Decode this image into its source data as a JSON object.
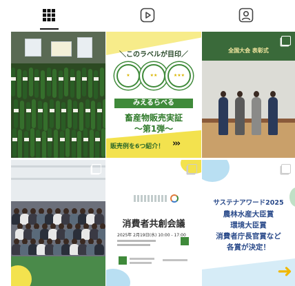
{
  "tabs": [
    {
      "name": "posts",
      "icon": "grid-icon",
      "active": true
    },
    {
      "name": "reels",
      "icon": "reels-icon",
      "active": false
    },
    {
      "name": "tagged",
      "icon": "tagged-user-icon",
      "active": false
    }
  ],
  "posts": {
    "post2": {
      "headline": "＼このラベルが目印／",
      "badges": [
        "★",
        "★★",
        "★★★"
      ],
      "band": "みえるらべる",
      "title_line1": "畜産物販売実証",
      "title_line2": "～第1弾～",
      "cta": "販売例を6つ紹介！",
      "arrows": "›››"
    },
    "post3": {
      "banner": "全国大会 表彰式"
    },
    "post5": {
      "title": "消費者共創会議",
      "date": "2025年 2月19日(水) 10:00 - 17:00"
    },
    "post6": {
      "line1": "サステナアワード2025",
      "line2": "農林水産大臣賞",
      "line3": "環境大臣賞",
      "line4": "消費者庁長官賞など",
      "line5": "各賞が決定！"
    }
  },
  "colors": {
    "accent_green": "#3f8a3a",
    "accent_yellow": "#f3e24e",
    "accent_blue": "#2a4a8a"
  }
}
